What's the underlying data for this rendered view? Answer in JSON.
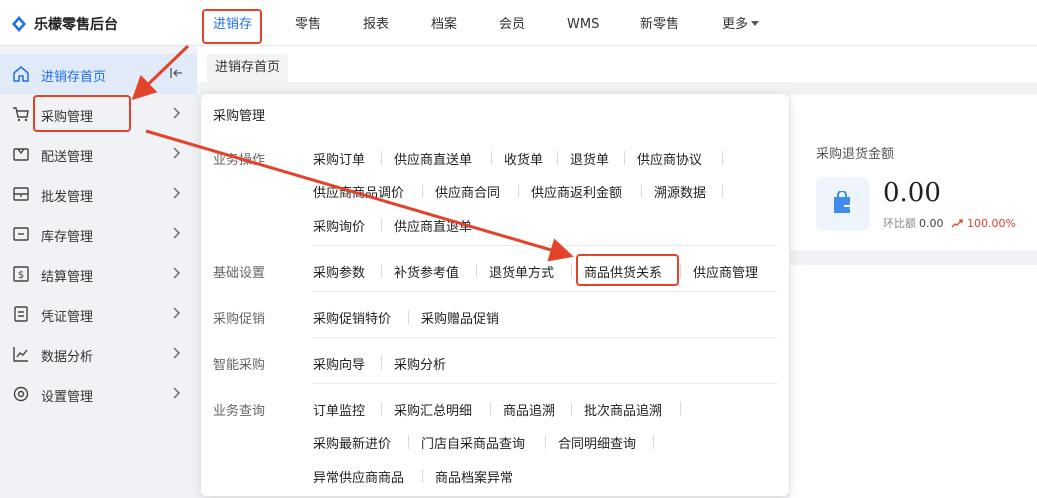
{
  "brand": {
    "name": "乐檬零售后台"
  },
  "topnav": {
    "items": [
      "进销存",
      "零售",
      "报表",
      "档案",
      "会员",
      "WMS",
      "新零售",
      "更多"
    ],
    "active": "进销存"
  },
  "sidebar": {
    "items": [
      {
        "label": "进销存首页",
        "icon": "home-icon"
      },
      {
        "label": "采购管理",
        "icon": "cart-icon"
      },
      {
        "label": "配送管理",
        "icon": "delivery-icon"
      },
      {
        "label": "批发管理",
        "icon": "wholesale-icon"
      },
      {
        "label": "库存管理",
        "icon": "inventory-icon"
      },
      {
        "label": "结算管理",
        "icon": "settlement-icon"
      },
      {
        "label": "凭证管理",
        "icon": "voucher-icon"
      },
      {
        "label": "数据分析",
        "icon": "chart-icon"
      },
      {
        "label": "设置管理",
        "icon": "settings-icon"
      }
    ]
  },
  "tabs": {
    "current": "进销存首页"
  },
  "card": {
    "title": "采购退货金额",
    "value": "0.00",
    "ratio_label": "环比额",
    "ratio_value": "0.00",
    "ratio_pct": "100.00%"
  },
  "panel": {
    "title": "采购管理",
    "groups": {
      "ops": {
        "label": "业务操作",
        "row1": [
          "采购订单",
          "供应商直送单",
          "收货单",
          "退货单",
          "供应商协议"
        ],
        "row2": [
          "供应商商品调价",
          "供应商合同",
          "供应商返利金额",
          "溯源数据"
        ],
        "row3": [
          "采购询价",
          "供应商直退单"
        ]
      },
      "basic": {
        "label": "基础设置",
        "row1": [
          "采购参数",
          "补货参考值",
          "退货单方式",
          "商品供货关系",
          "供应商管理"
        ]
      },
      "promo": {
        "label": "采购促销",
        "row1": [
          "采购促销特价",
          "采购赠品促销"
        ]
      },
      "smart": {
        "label": "智能采购",
        "row1": [
          "采购向导",
          "采购分析"
        ]
      },
      "query": {
        "label": "业务查询",
        "row1": [
          "订单监控",
          "采购汇总明细",
          "商品追溯",
          "批次商品追溯"
        ],
        "row2": [
          "采购最新进价",
          "门店自采商品查询",
          "合同明细查询"
        ],
        "row3": [
          "异常供应商商品",
          "商品档案异常"
        ]
      }
    }
  },
  "colors": {
    "accent": "#1f6fe5",
    "annotation": "#e3422b",
    "trend": "#e3422b"
  }
}
